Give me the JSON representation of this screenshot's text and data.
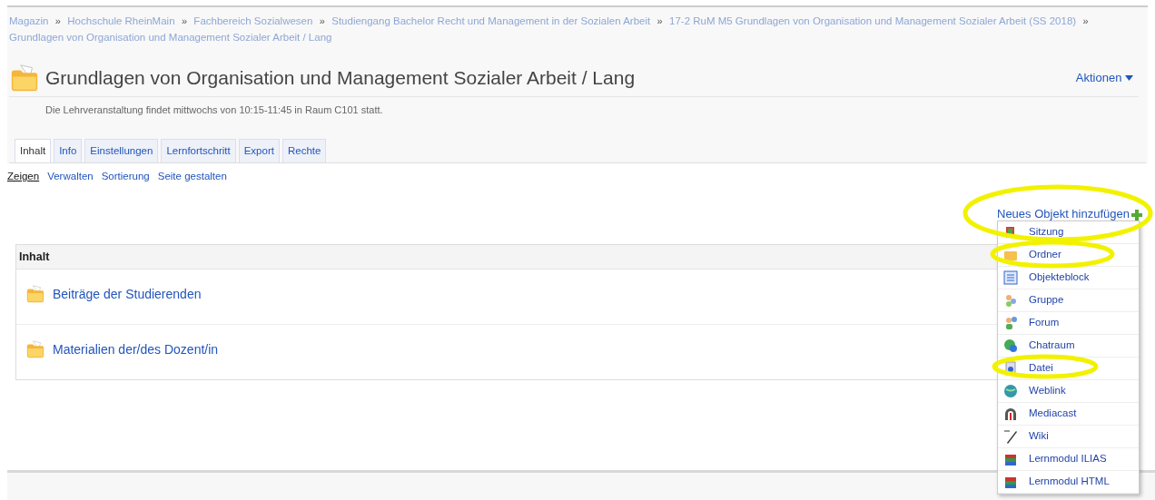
{
  "breadcrumb": [
    {
      "kind": "link",
      "text": "Magazin"
    },
    {
      "kind": "sep",
      "text": "»"
    },
    {
      "kind": "link",
      "text": "Hochschule RheinMain"
    },
    {
      "kind": "sep",
      "text": "»"
    },
    {
      "kind": "link",
      "text": "Fachbereich Sozialwesen"
    },
    {
      "kind": "sep",
      "text": "»"
    },
    {
      "kind": "link",
      "text": "Studiengang Bachelor Recht und Management in der Sozialen Arbeit"
    },
    {
      "kind": "sep",
      "text": "»"
    },
    {
      "kind": "link",
      "text": "17-2 RuM M5 Grundlagen von Organisation und Management Sozialer Arbeit (SS 2018)"
    },
    {
      "kind": "sep",
      "text": "»"
    },
    {
      "kind": "link",
      "text": "Grundlagen von Organisation und Management Sozialer Arbeit / Lang"
    }
  ],
  "header": {
    "title": "Grundlagen von Organisation und Management Sozialer Arbeit / Lang",
    "description": "Die Lehrveranstaltung findet mittwochs von 10:15-11:45 in Raum C101 statt.",
    "actions": "Aktionen"
  },
  "tabs": [
    {
      "label": "Inhalt",
      "selected": true
    },
    {
      "label": "Info",
      "selected": false
    },
    {
      "label": "Einstellungen",
      "selected": false
    },
    {
      "label": "Lernfortschritt",
      "selected": false
    },
    {
      "label": "Export",
      "selected": false
    },
    {
      "label": "Rechte",
      "selected": false
    }
  ],
  "subtabs": [
    {
      "label": "Zeigen",
      "selected": true
    },
    {
      "label": "Verwalten",
      "selected": false
    },
    {
      "label": "Sortierung",
      "selected": false
    },
    {
      "label": "Seite gestalten",
      "selected": false
    }
  ],
  "add_object": {
    "label": "Neues Objekt hinzufügen",
    "menu": [
      {
        "label": "Sitzung"
      },
      {
        "label": "Ordner"
      },
      {
        "label": "Objekteblock"
      },
      {
        "label": "Gruppe"
      },
      {
        "label": "Forum"
      },
      {
        "label": "Chatraum"
      },
      {
        "label": "Datei"
      },
      {
        "label": "Weblink"
      },
      {
        "label": "Mediacast"
      },
      {
        "label": "Wiki"
      },
      {
        "label": "Lernmodul ILIAS"
      },
      {
        "label": "Lernmodul HTML"
      }
    ]
  },
  "content": {
    "heading": "Inhalt",
    "items": [
      {
        "label": "Beiträge der Studierenden"
      },
      {
        "label": "Materialien der/des Dozent/in"
      }
    ]
  }
}
